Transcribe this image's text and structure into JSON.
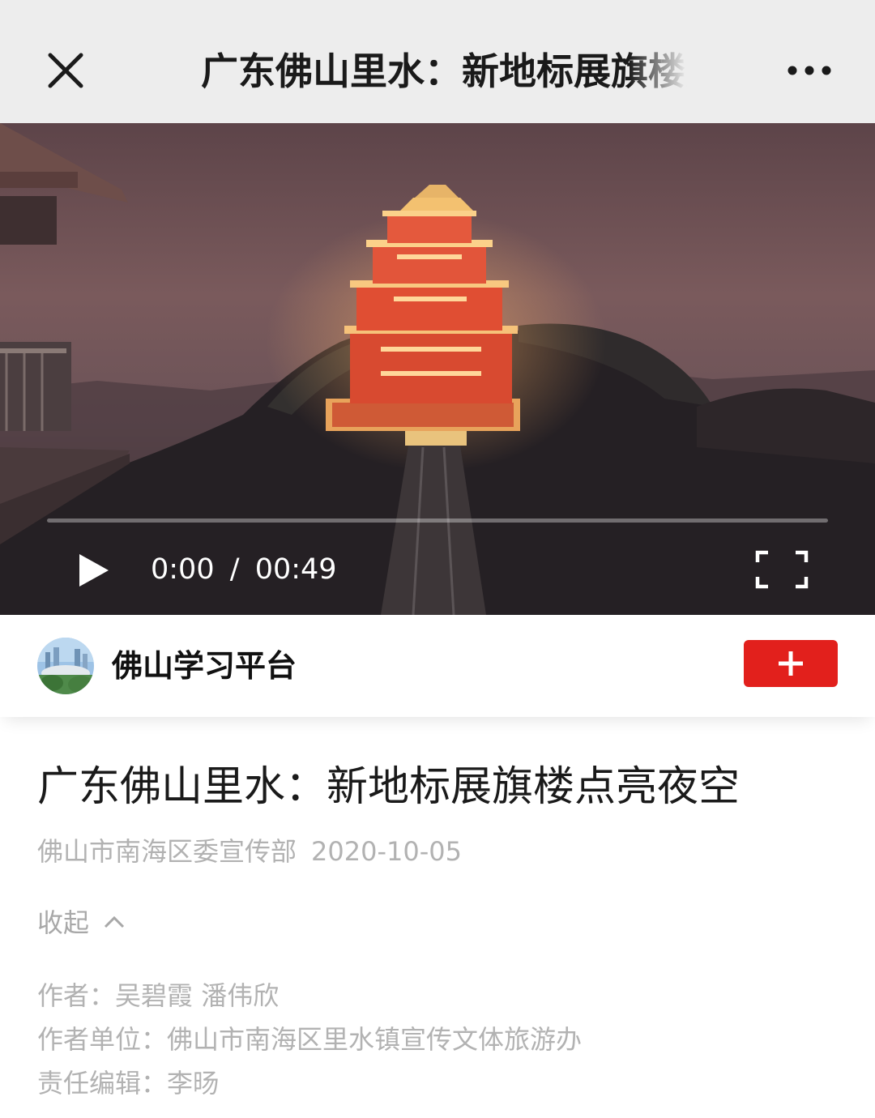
{
  "nav": {
    "title": "广东佛山里水：新地标展旗楼点亮夜空",
    "close_icon": "close-icon",
    "more_icon": "more-dots-icon"
  },
  "video": {
    "current_time": "0:00",
    "separator": "/",
    "duration": "00:49",
    "progress": 0,
    "play_icon": "play-icon",
    "fullscreen_icon": "fullscreen-icon"
  },
  "account": {
    "name": "佛山学习平台",
    "follow_icon": "plus-icon",
    "follow_color": "#e2201c"
  },
  "article": {
    "title": "广东佛山里水：新地标展旗楼点亮夜空",
    "source": "佛山市南海区委宣传部",
    "date": "2020-10-05",
    "collapse_label": "收起",
    "collapse_icon": "chevron-up-icon",
    "credits": [
      {
        "label": "作者：",
        "value": "吴碧霞 潘伟欣"
      },
      {
        "label": "作者单位：",
        "value": "佛山市南海区里水镇宣传文体旅游办"
      },
      {
        "label": "责任编辑：",
        "value": "李旸"
      }
    ]
  }
}
